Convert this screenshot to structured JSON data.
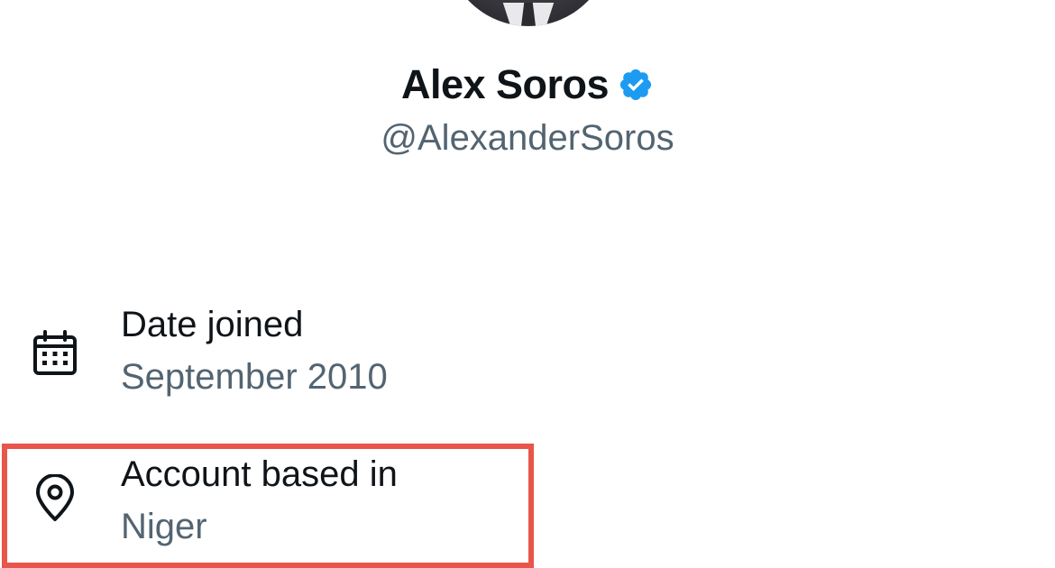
{
  "profile": {
    "display_name": "Alex Soros",
    "handle": "@AlexanderSoros",
    "verified": true,
    "verified_color": "#1d9bf0",
    "avatar_icon": "avatar-photo"
  },
  "about": {
    "date_joined": {
      "label": "Date joined",
      "value": "September 2010",
      "icon": "calendar-icon"
    },
    "account_location": {
      "label": "Account based in",
      "value": "Niger",
      "icon": "location-pin-icon",
      "highlighted": true,
      "highlight_color": "#e8554a"
    }
  },
  "colors": {
    "text_primary": "#0f1419",
    "text_secondary": "#536471",
    "background": "#ffffff"
  }
}
